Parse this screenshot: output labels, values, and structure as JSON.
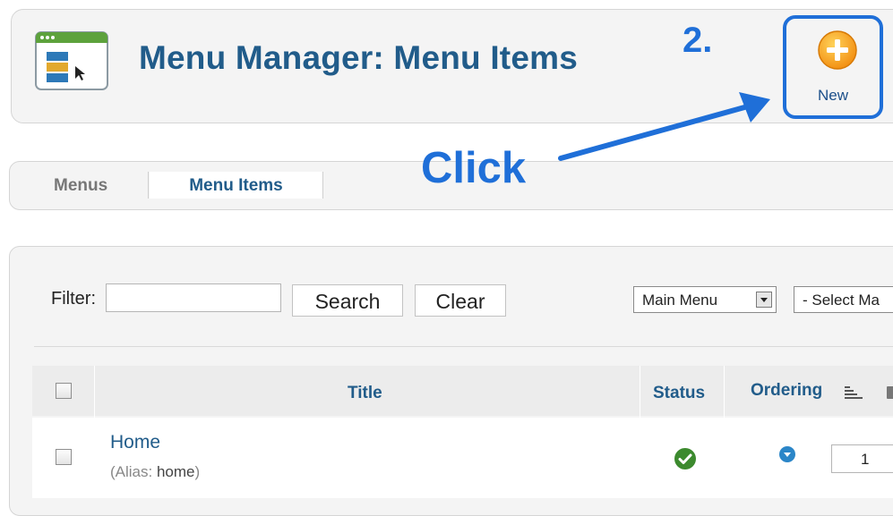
{
  "header": {
    "title": "Menu Manager: Menu Items",
    "step_label": "2.",
    "new_button_label": "New"
  },
  "tabs": [
    {
      "label": "Menus",
      "active": false
    },
    {
      "label": "Menu Items",
      "active": true
    }
  ],
  "annotation": {
    "click_label": "Click"
  },
  "filter": {
    "label": "Filter:",
    "value": "",
    "search_label": "Search",
    "clear_label": "Clear",
    "menu_select_value": "Main Menu",
    "level_select_value": "- Select Ma"
  },
  "table": {
    "columns": {
      "title": "Title",
      "status": "Status",
      "ordering": "Ordering"
    },
    "rows": [
      {
        "title": "Home",
        "alias_prefix": "(Alias: ",
        "alias": "home",
        "alias_suffix": ")",
        "status": "published",
        "order": "1"
      }
    ]
  },
  "icons": {
    "app": "menu-manager-icon",
    "new": "plus-circle-icon",
    "status": "published-check-icon",
    "order_down": "move-down-icon",
    "sort": "sort-icon",
    "save_order": "save-order-icon"
  },
  "colors": {
    "accent": "#1f6fd8",
    "title": "#215c8a",
    "new_button": "#f6a91a",
    "published": "#3c8a2e"
  }
}
